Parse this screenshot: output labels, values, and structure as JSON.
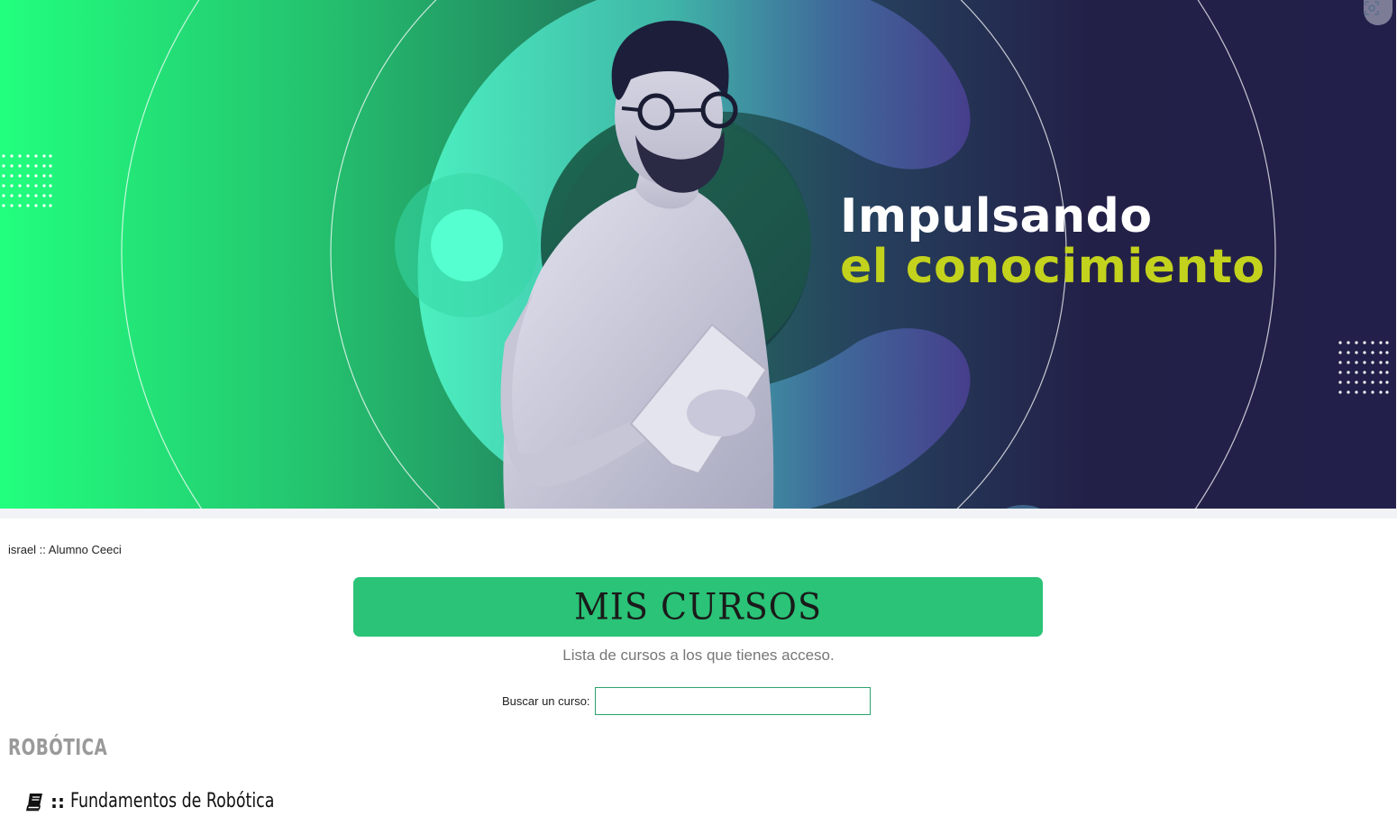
{
  "hero": {
    "headline_line1": "Impulsando",
    "headline_line2": "el conocimiento",
    "headline_color_primary": "#ffffff",
    "headline_color_accent": "#c3d21c",
    "image_subject": "man-with-glasses-holding-tablet",
    "lens_icon": "visual-search-icon"
  },
  "user": {
    "label": "israel :: Alumno Ceeci"
  },
  "courses_page": {
    "title": "MIS CURSOS",
    "title_bar_color": "#2ac377",
    "subtitle": "Lista de cursos a los que tienes acceso.",
    "search_label": "Buscar un curso:",
    "search_value": "",
    "search_placeholder": ""
  },
  "categories": [
    {
      "name": "ROBÓTICA",
      "courses": [
        {
          "icon": "book-icon",
          "separator": "::",
          "name": "Fundamentos de Robótica"
        }
      ]
    }
  ]
}
